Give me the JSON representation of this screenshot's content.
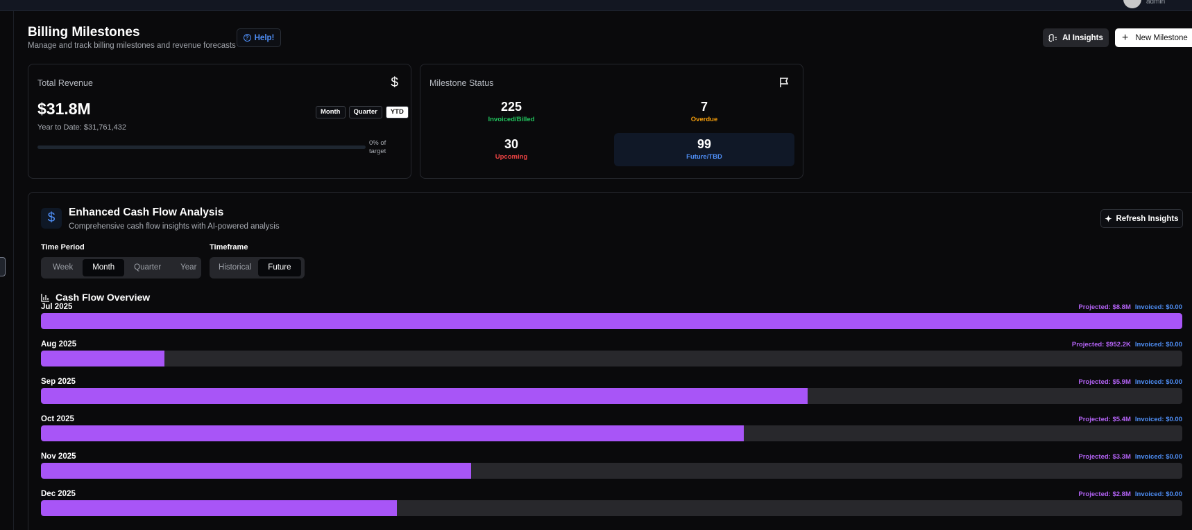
{
  "header": {
    "user_role": "admin"
  },
  "page": {
    "title": "Billing Milestones",
    "subtitle": "Manage and track billing milestones and revenue forecasts",
    "help_label": "Help!",
    "ai_insights_label": "AI Insights",
    "new_milestone_label": "New Milestone"
  },
  "revenue": {
    "label": "Total Revenue",
    "value": "$31.8M",
    "ytd_text": "Year to Date: $31,761,432",
    "periods": [
      "Month",
      "Quarter",
      "YTD"
    ],
    "active_period": "YTD",
    "progress_fraction": 0,
    "progress_text": "0% of target"
  },
  "milestone_status": {
    "label": "Milestone Status",
    "items": [
      {
        "count": "225",
        "label": "Invoiced/Billed",
        "color": "#22c55e"
      },
      {
        "count": "7",
        "label": "Overdue",
        "color": "#f59e0b"
      },
      {
        "count": "30",
        "label": "Upcoming",
        "color": "#ef4444"
      },
      {
        "count": "99",
        "label": "Future/TBD",
        "color": "#4f8ff7"
      }
    ]
  },
  "cashflow": {
    "title": "Enhanced Cash Flow Analysis",
    "subtitle": "Comprehensive cash flow insights with AI-powered analysis",
    "refresh_label": "Refresh Insights",
    "time_period_label": "Time Period",
    "time_period_options": [
      "Week",
      "Month",
      "Quarter",
      "Year"
    ],
    "time_period_active": "Month",
    "timeframe_label": "Timeframe",
    "timeframe_options": [
      "Historical",
      "Future"
    ],
    "timeframe_active": "Future",
    "overview_title": "Cash Flow Overview",
    "rows": [
      {
        "month": "Jul 2025",
        "projected": "Projected: $8.8M",
        "invoiced": "Invoiced: $0.00",
        "fraction": 1.0
      },
      {
        "month": "Aug 2025",
        "projected": "Projected: $952.2K",
        "invoiced": "Invoiced: $0.00",
        "fraction": 0.108
      },
      {
        "month": "Sep 2025",
        "projected": "Projected: $5.9M",
        "invoiced": "Invoiced: $0.00",
        "fraction": 0.672
      },
      {
        "month": "Oct 2025",
        "projected": "Projected: $5.4M",
        "invoiced": "Invoiced: $0.00",
        "fraction": 0.616
      },
      {
        "month": "Nov 2025",
        "projected": "Projected: $3.3M",
        "invoiced": "Invoiced: $0.00",
        "fraction": 0.377
      },
      {
        "month": "Dec 2025",
        "projected": "Projected: $2.8M",
        "invoiced": "Invoiced: $0.00",
        "fraction": 0.312
      }
    ]
  }
}
